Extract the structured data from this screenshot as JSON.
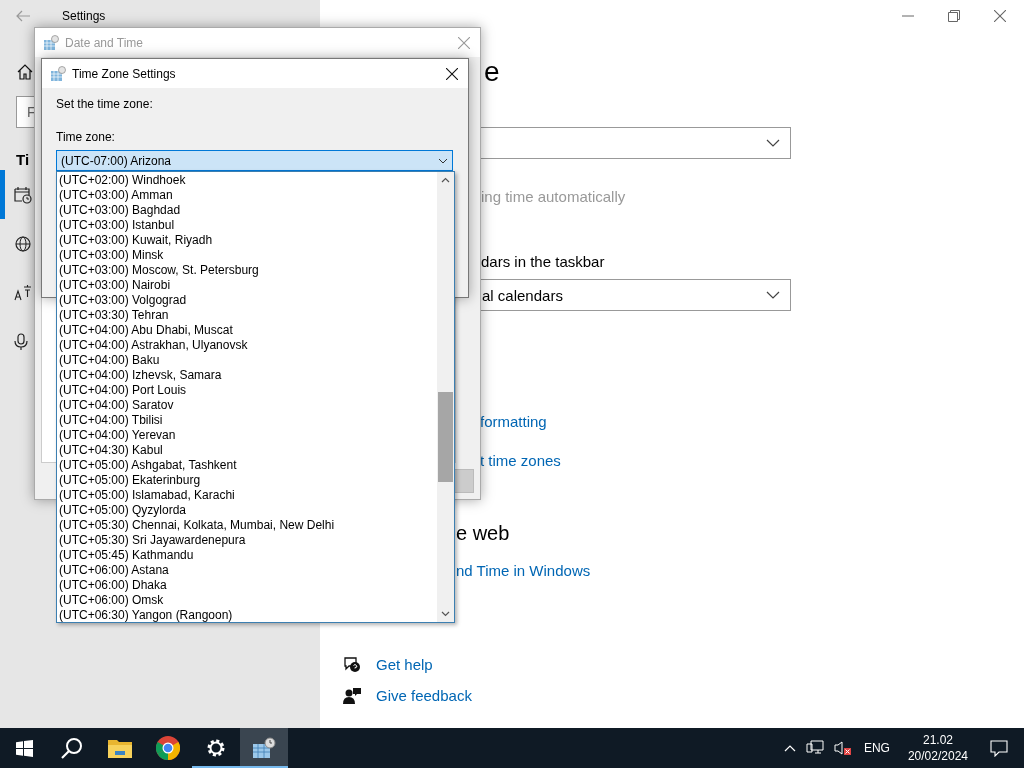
{
  "settings_window": {
    "title": "Settings",
    "sidebar": {
      "search": {
        "placeholder": "F"
      },
      "heading": "Ti",
      "nav_items": [
        {
          "selected": true
        },
        {
          "selected": false
        },
        {
          "selected": false
        },
        {
          "selected": false
        }
      ]
    },
    "content": {
      "heading": "e",
      "dst_label": {
        "text": "ing time automatically",
        "disabled": true
      },
      "calendar_label": "dars in the taskbar",
      "calendar_dropdown": {
        "value": "al calendars"
      },
      "links": [
        "formatting",
        "t time zones"
      ],
      "web_heading": "e web",
      "web_link": "nd Time in Windows",
      "help_links": [
        "Get help",
        "Give feedback"
      ]
    }
  },
  "date_time_dialog": {
    "title": "Date and Time",
    "active": false
  },
  "time_zone_dialog": {
    "title": "Time Zone Settings",
    "active": true,
    "prompt": "Set the time zone:",
    "field_label": "Time zone:",
    "dropdown": {
      "value": "(UTC-07:00) Arizona",
      "expanded": true,
      "options": [
        {
          "label": "(UTC+02:00) Windhoek",
          "selected": false
        },
        {
          "label": "(UTC+03:00) Amman",
          "selected": false
        },
        {
          "label": "(UTC+03:00) Baghdad",
          "selected": false
        },
        {
          "label": "(UTC+03:00) Istanbul",
          "selected": false
        },
        {
          "label": "(UTC+03:00) Kuwait, Riyadh",
          "selected": false
        },
        {
          "label": "(UTC+03:00) Minsk",
          "selected": false
        },
        {
          "label": "(UTC+03:00) Moscow, St. Petersburg",
          "selected": false
        },
        {
          "label": "(UTC+03:00) Nairobi",
          "selected": false
        },
        {
          "label": "(UTC+03:00) Volgograd",
          "selected": false
        },
        {
          "label": "(UTC+03:30) Tehran",
          "selected": false
        },
        {
          "label": "(UTC+04:00) Abu Dhabi, Muscat",
          "selected": false
        },
        {
          "label": "(UTC+04:00) Astrakhan, Ulyanovsk",
          "selected": false
        },
        {
          "label": "(UTC+04:00) Baku",
          "selected": false
        },
        {
          "label": "(UTC+04:00) Izhevsk, Samara",
          "selected": false
        },
        {
          "label": "(UTC+04:00) Port Louis",
          "selected": false
        },
        {
          "label": "(UTC+04:00) Saratov",
          "selected": false
        },
        {
          "label": "(UTC+04:00) Tbilisi",
          "selected": false
        },
        {
          "label": "(UTC+04:00) Yerevan",
          "selected": false
        },
        {
          "label": "(UTC+04:30) Kabul",
          "selected": false
        },
        {
          "label": "(UTC+05:00) Ashgabat, Tashkent",
          "selected": false
        },
        {
          "label": "(UTC+05:00) Ekaterinburg",
          "selected": false
        },
        {
          "label": "(UTC+05:00) Islamabad, Karachi",
          "selected": false
        },
        {
          "label": "(UTC+05:00) Qyzylorda",
          "selected": false
        },
        {
          "label": "(UTC+05:30) Chennai, Kolkata, Mumbai, New Delhi",
          "selected": false
        },
        {
          "label": "(UTC+05:30) Sri Jayawardenepura",
          "selected": false
        },
        {
          "label": "(UTC+05:45) Kathmandu",
          "selected": false
        },
        {
          "label": "(UTC+06:00) Astana",
          "selected": false
        },
        {
          "label": "(UTC+06:00) Dhaka",
          "selected": false
        },
        {
          "label": "(UTC+06:00) Omsk",
          "selected": false
        },
        {
          "label": "(UTC+06:30) Yangon (Rangoon)",
          "selected": false
        }
      ]
    }
  },
  "taskbar": {
    "apps": [
      {
        "running": false,
        "active": false
      },
      {
        "running": false,
        "active": false
      },
      {
        "running": false,
        "active": false
      },
      {
        "running": true,
        "active": false
      },
      {
        "running": true,
        "active": true
      }
    ],
    "tray": {
      "volume_muted": true,
      "language": "ENG",
      "time": "21.02",
      "date": "20/02/2024"
    }
  }
}
